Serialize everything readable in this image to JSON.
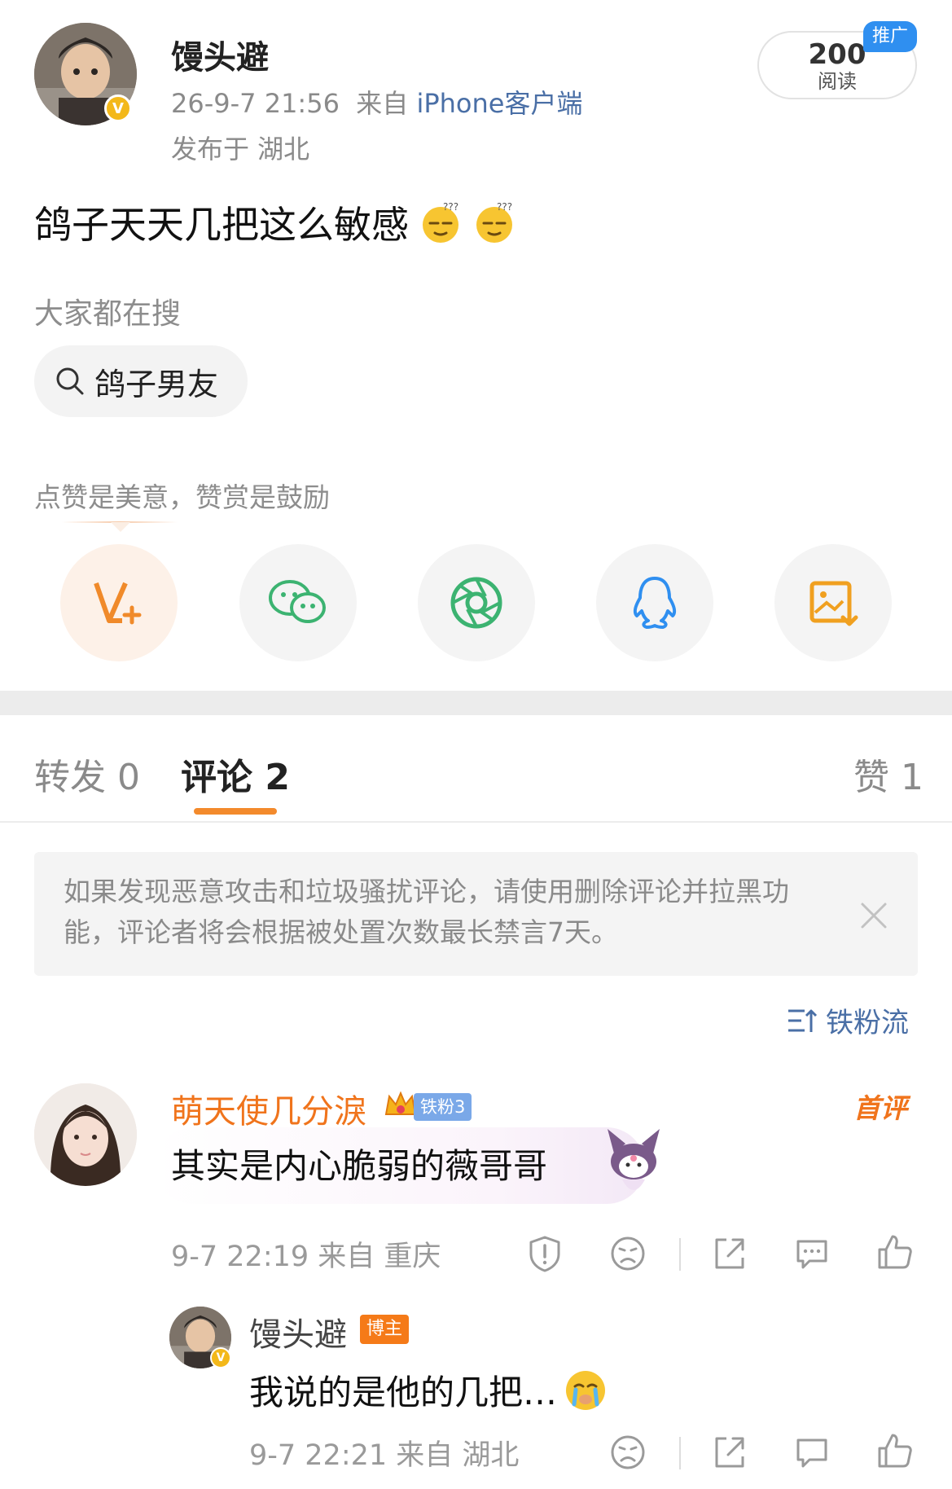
{
  "post": {
    "author": "馒头避",
    "time": "26-9-7 21:56",
    "source_prefix": "来自",
    "source": "iPhone客户端",
    "location": "发布于 湖北",
    "read_count": "200",
    "read_label": "阅读",
    "promo_tag": "推广",
    "text": "鸽子天天几把这么敏感"
  },
  "search": {
    "title": "大家都在搜",
    "chip": "鸽子男友"
  },
  "reward": {
    "title": "点赞是美意，赞赏是鼓励"
  },
  "share": [
    "v-plus-icon",
    "wechat-icon",
    "moments-icon",
    "qq-icon",
    "save-image-icon"
  ],
  "tabs": {
    "repost": "转发 0",
    "comments": "评论 2",
    "likes": "赞 1"
  },
  "notice": {
    "text": "如果发现恶意攻击和垃圾骚扰评论，请使用删除评论并拉黑功能，评论者将会根据被处置次数最长禁言7天。"
  },
  "sort": {
    "label": "铁粉流"
  },
  "comments": [
    {
      "name": "萌天使几分淚",
      "badge": "铁粉3",
      "tag": "首评",
      "text": "其实是内心脆弱的薇哥哥",
      "meta": "9-7 22:19 来自 重庆"
    }
  ],
  "reply": {
    "name": "馒头避",
    "badge": "博主",
    "text": "我说的是他的几把…",
    "meta": "9-7 22:21 来自 湖北"
  },
  "colors": {
    "accent_orange": "#f38a2c",
    "link_blue": "#4a6fa6",
    "name_orange": "#f0741c"
  }
}
